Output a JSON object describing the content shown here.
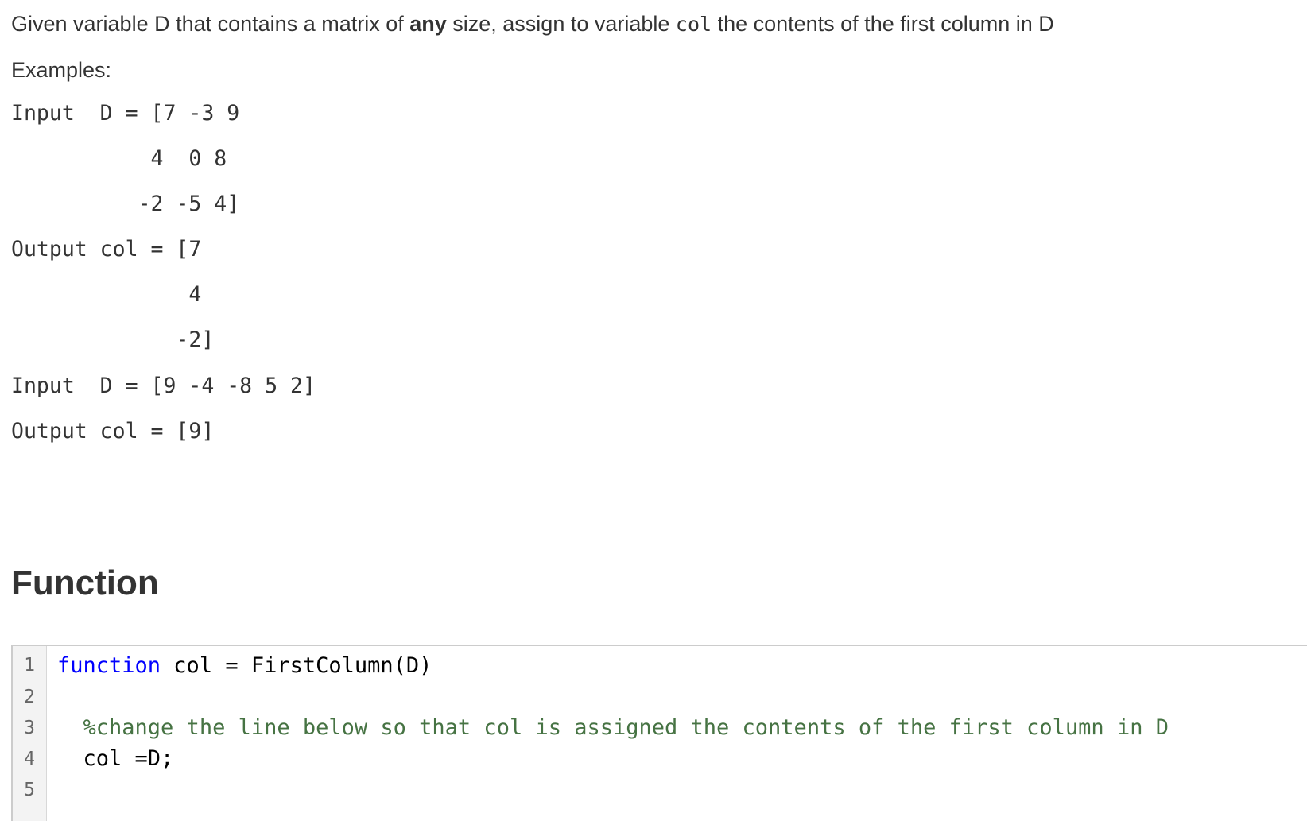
{
  "problem": {
    "description_before_bold": "Given variable D that contains a matrix of ",
    "description_bold": "any",
    "description_mid": " size, assign to variable ",
    "description_code": "col",
    "description_after": " the contents of the first column in D",
    "examples_label": "Examples:",
    "example_lines": [
      "Input  D = [7 -3 9",
      "           4  0 8",
      "          -2 -5 4]",
      "Output col = [7",
      "              4",
      "             -2]",
      "Input  D = [9 -4 -8 5 2]",
      "Output col = [9]"
    ]
  },
  "function_section": {
    "title": "Function",
    "line_numbers": [
      "1",
      "2",
      "3",
      "4",
      "5"
    ],
    "code_lines": [
      {
        "keyword": "function",
        "text": " col = FirstColumn(D)",
        "comment": ""
      },
      {
        "keyword": "",
        "text": "",
        "comment": ""
      },
      {
        "keyword": "",
        "text": "  ",
        "comment": "%change the line below so that col is assigned the contents of the first column in D"
      },
      {
        "keyword": "",
        "text": "  col =D;",
        "comment": ""
      },
      {
        "keyword": "",
        "text": "",
        "comment": ""
      }
    ],
    "colors": {
      "keyword": "#0000ff",
      "comment": "#467343",
      "text": "#000000"
    }
  }
}
